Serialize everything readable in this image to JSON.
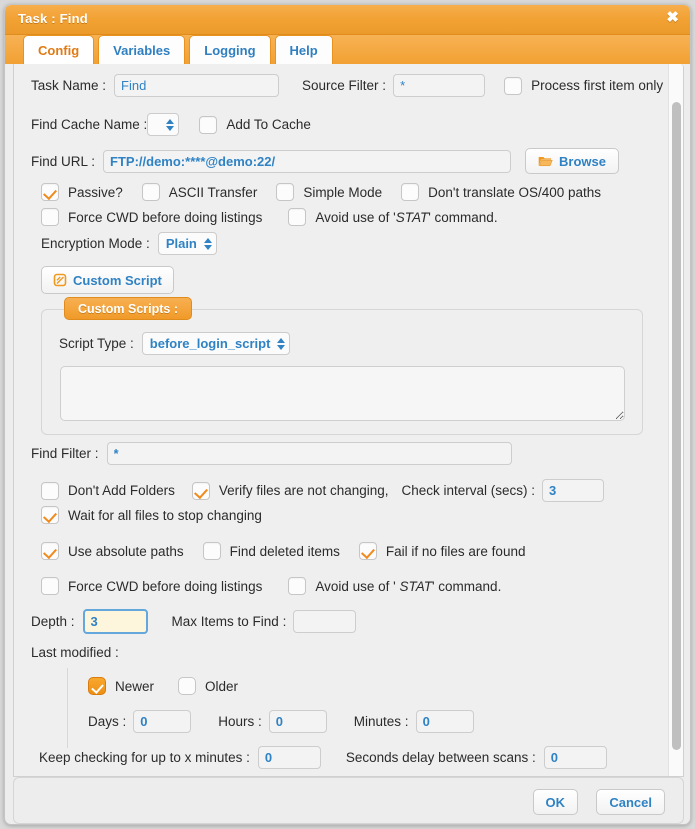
{
  "window": {
    "title": "Task : Find",
    "close_label": "✖"
  },
  "tabs": [
    {
      "label": "Config",
      "active": true
    },
    {
      "label": "Variables",
      "active": false
    },
    {
      "label": "Logging",
      "active": false
    },
    {
      "label": "Help",
      "active": false
    }
  ],
  "form": {
    "task_name_label": "Task Name :",
    "task_name_value": "Find",
    "source_filter_label": "Source Filter :",
    "source_filter_value": "*",
    "process_first_item_only_label": "Process first item only",
    "process_first_item_only_checked": false,
    "find_cache_name_label": "Find Cache Name :",
    "find_cache_name_value": "",
    "add_to_cache_label": "Add To Cache",
    "add_to_cache_checked": false,
    "find_url_label": "Find URL :",
    "find_url_value": "FTP://demo:****@demo:22/",
    "browse_label": "Browse",
    "passive_label": "Passive?",
    "passive_checked": true,
    "ascii_transfer_label": "ASCII Transfer",
    "ascii_transfer_checked": false,
    "simple_mode_label": "Simple Mode",
    "simple_mode_checked": false,
    "dont_translate_label": "Don't translate OS/400 paths",
    "dont_translate_checked": false,
    "force_cwd_label_1": "Force CWD before doing listings",
    "force_cwd_checked_1": false,
    "avoid_stat_prefix_1": "Avoid use of '",
    "avoid_stat_em_1": "STAT",
    "avoid_stat_suffix_1": "' command.",
    "avoid_stat_checked_1": false,
    "encryption_mode_label": "Encryption Mode :",
    "encryption_mode_value": "Plain",
    "custom_script_button_label": "Custom Script",
    "custom_scripts_legend": "Custom Scripts :",
    "script_type_label": "Script Type :",
    "script_type_value": "before_login_script",
    "script_body_value": "",
    "find_filter_label": "Find Filter :",
    "find_filter_value": "*",
    "dont_add_folders_label": "Don't Add Folders",
    "dont_add_folders_checked": false,
    "verify_files_label": "Verify files are not changing,",
    "verify_files_checked": true,
    "check_interval_label": "Check interval (secs) :",
    "check_interval_value": "3",
    "wait_for_all_files_label": "Wait for all files to stop changing",
    "wait_for_all_files_checked": true,
    "use_absolute_paths_label": "Use absolute paths",
    "use_absolute_paths_checked": true,
    "find_deleted_items_label": "Find deleted items",
    "find_deleted_items_checked": false,
    "fail_if_no_files_label": "Fail if no files are found",
    "fail_if_no_files_checked": true,
    "force_cwd_label_2": "Force CWD before doing listings",
    "force_cwd_checked_2": false,
    "avoid_stat_prefix_2": "Avoid use of ' ",
    "avoid_stat_em_2": "STAT",
    "avoid_stat_suffix_2": "' command.",
    "avoid_stat_checked_2": false,
    "depth_label": "Depth :",
    "depth_value": "3",
    "max_items_label": "Max Items to Find :",
    "max_items_value": "",
    "last_modified_label": "Last modified :",
    "newer_label": "Newer",
    "newer_selected": true,
    "older_label": "Older",
    "older_selected": false,
    "days_label": "Days :",
    "days_value": "0",
    "hours_label": "Hours :",
    "hours_value": "0",
    "minutes_label": "Minutes :",
    "minutes_value": "0",
    "keep_checking_label": "Keep checking for up to x minutes :",
    "keep_checking_value": "0",
    "seconds_delay_label": "Seconds delay between scans :",
    "seconds_delay_value": "0"
  },
  "footer": {
    "ok_label": "OK",
    "cancel_label": "Cancel"
  },
  "colors": {
    "accent_orange": "#f2a133",
    "link_blue": "#2f82c4",
    "panel_gray": "#efefef"
  }
}
